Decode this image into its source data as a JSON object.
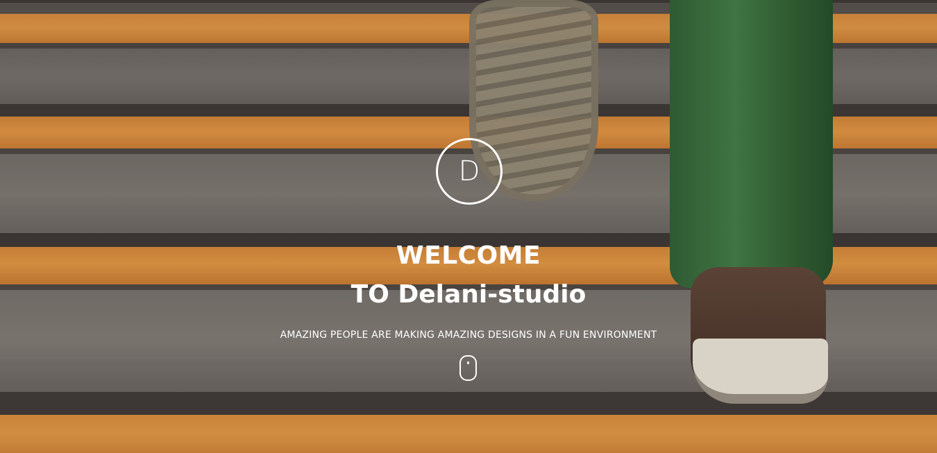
{
  "hero": {
    "logo_letter": "D",
    "title_line1": "WELCOME",
    "title_line2": "TO Delani-studio",
    "tagline": "AMAZING PEOPLE ARE MAKING AMAZING DESIGNS IN A FUN ENVIRONMENT",
    "scroll_icon": "mouse-scroll-icon"
  },
  "colors": {
    "accent_orange": "#f0a048",
    "text": "#ffffff"
  }
}
